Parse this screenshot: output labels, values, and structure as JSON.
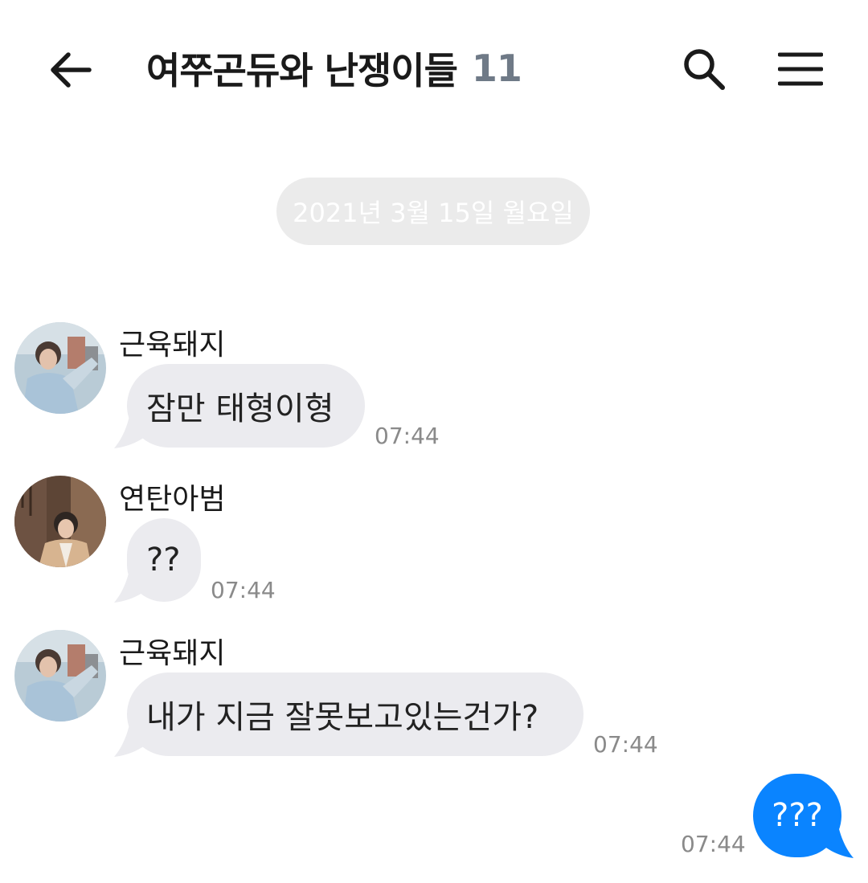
{
  "header": {
    "title": "여쭈곤듀와 난쟁이들",
    "member_count": "11",
    "back_icon": "arrow-left-icon",
    "search_icon": "search-icon",
    "menu_icon": "hamburger-menu-icon"
  },
  "date_divider": "2021년 3월 15일 월요일",
  "messages": [
    {
      "sender": "근육돼지",
      "text": "잠만 태형이형",
      "time": "07:44"
    },
    {
      "sender": "연탄아범",
      "text": "??",
      "time": "07:44"
    },
    {
      "sender": "근육돼지",
      "text": "내가 지금 잘못보고있는건가?",
      "time": "07:44"
    }
  ],
  "my_message": {
    "text": "???",
    "time": "07:44"
  },
  "colors": {
    "bubble_incoming": "#ebebef",
    "bubble_outgoing": "#0a84ff",
    "date_pill": "#ebebeb",
    "member_count": "#6f7a87",
    "timestamp": "#8a8a8a"
  }
}
